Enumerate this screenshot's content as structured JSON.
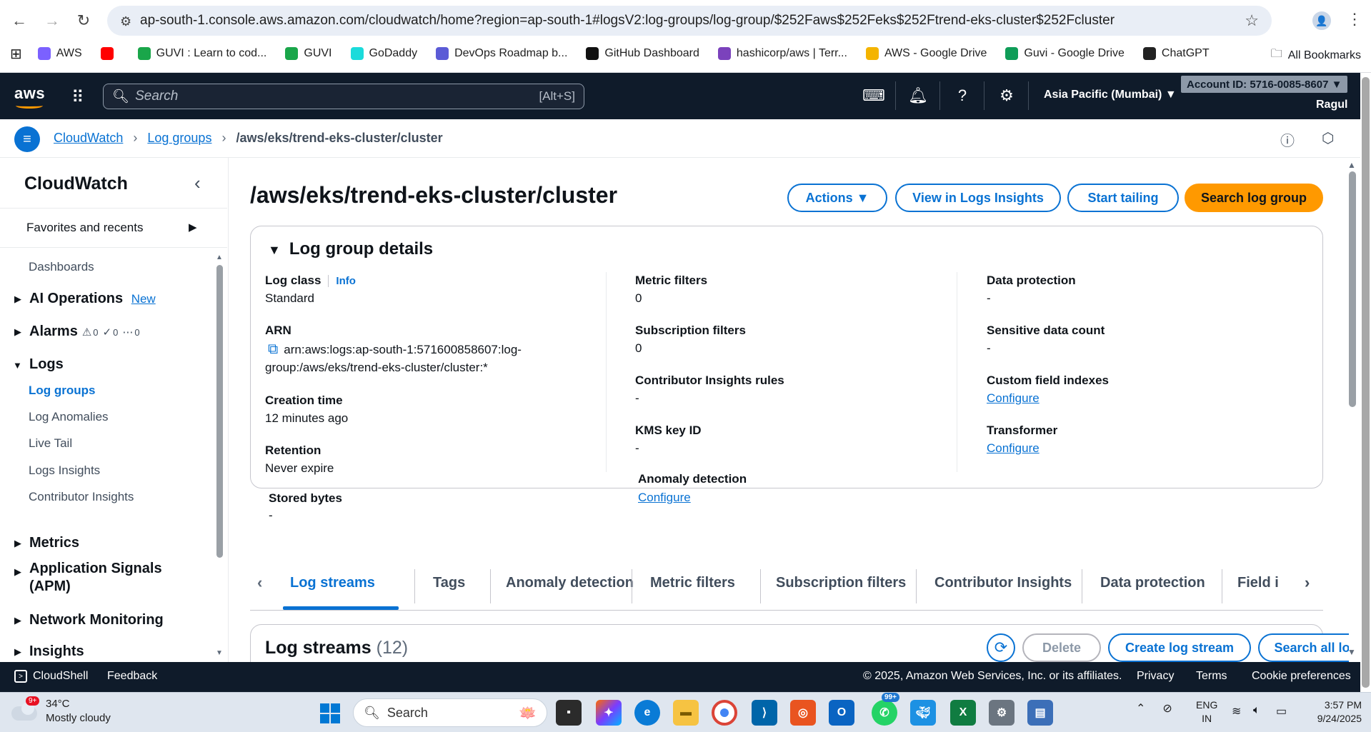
{
  "browser": {
    "url": "ap-south-1.console.aws.amazon.com/cloudwatch/home?region=ap-south-1#logsV2:log-groups/log-group/$252Faws$252Feks$252Ftrend-eks-cluster$252Fcluster",
    "bookmarks": [
      {
        "label": "AWS",
        "icon": "aws-cube-icon",
        "color": "#7b61ff"
      },
      {
        "label": "",
        "icon": "youtube-icon",
        "color": "#ff0000"
      },
      {
        "label": "GUVI : Learn to cod...",
        "icon": "guvi-icon",
        "color": "#1aa64a"
      },
      {
        "label": "GUVI",
        "icon": "guvi-icon",
        "color": "#1aa64a"
      },
      {
        "label": "GoDaddy",
        "icon": "godaddy-icon",
        "color": "#1bdbdb"
      },
      {
        "label": "DevOps Roadmap b...",
        "icon": "roadmap-icon",
        "color": "#5b5bd6"
      },
      {
        "label": "GitHub Dashboard",
        "icon": "github-icon",
        "color": "#111111"
      },
      {
        "label": "hashicorp/aws | Terr...",
        "icon": "terraform-icon",
        "color": "#7b42bc"
      },
      {
        "label": "AWS - Google Drive",
        "icon": "folder-icon",
        "color": "#f4b400"
      },
      {
        "label": "Guvi - Google Drive",
        "icon": "google-drive-icon",
        "color": "#0f9d58"
      },
      {
        "label": "ChatGPT",
        "icon": "chatgpt-icon",
        "color": "#222222"
      }
    ],
    "all_bookmarks": "All Bookmarks"
  },
  "aws_header": {
    "logo": "aws",
    "search_placeholder": "Search",
    "search_shortcut": "[Alt+S]",
    "region": "Asia Pacific (Mumbai) ▼",
    "account": "Account ID: 5716-0085-8607 ▼",
    "user": "Ragul"
  },
  "breadcrumb": {
    "items": [
      "CloudWatch",
      "Log groups"
    ],
    "current": "/aws/eks/trend-eks-cluster/cluster"
  },
  "sidebar": {
    "title": "CloudWatch",
    "favorites": "Favorites and recents",
    "dashboards": "Dashboards",
    "ai_operations": "AI Operations",
    "ai_new": "New",
    "alarms": "Alarms",
    "alarm_counts": [
      "0",
      "0",
      "0"
    ],
    "logs": "Logs",
    "log_items": [
      "Log groups",
      "Log Anomalies",
      "Live Tail",
      "Logs Insights",
      "Contributor Insights"
    ],
    "metrics": "Metrics",
    "app_signals": "Application Signals",
    "app_signals_2": "(APM)",
    "network": "Network Monitoring",
    "insights": "Insights"
  },
  "main": {
    "title": "/aws/eks/trend-eks-cluster/cluster",
    "buttons": {
      "actions": "Actions ▼",
      "view_insights": "View in Logs Insights",
      "start_tailing": "Start tailing",
      "search": "Search log group"
    },
    "details_title": "Log group details",
    "col1": {
      "log_class_label": "Log class",
      "info": "Info",
      "log_class": "Standard",
      "arn_label": "ARN",
      "arn": "arn:aws:logs:ap-south-1:571600858607:log-group:/aws/eks/trend-eks-cluster/cluster:*",
      "creation_label": "Creation time",
      "creation": "12 minutes ago",
      "retention_label": "Retention",
      "retention": "Never expire",
      "stored_label": "Stored bytes",
      "stored": "-"
    },
    "col2": {
      "metric_filters_label": "Metric filters",
      "metric_filters": "0",
      "subscription_label": "Subscription filters",
      "subscription": "0",
      "contributor_label": "Contributor Insights rules",
      "contributor": "-",
      "kms_label": "KMS key ID",
      "kms": "-",
      "anomaly_label": "Anomaly detection",
      "anomaly": "Configure"
    },
    "col3": {
      "data_protection_label": "Data protection",
      "data_protection": "-",
      "sensitive_label": "Sensitive data count",
      "sensitive": "-",
      "custom_label": "Custom field indexes",
      "custom": "Configure",
      "transformer_label": "Transformer",
      "transformer": "Configure"
    },
    "tabs": [
      "Log streams",
      "Tags",
      "Anomaly detection",
      "Metric filters",
      "Subscription filters",
      "Contributor Insights",
      "Data protection",
      "Field i"
    ],
    "streams_title": "Log streams",
    "streams_count": "(12)",
    "stream_buttons": {
      "delete": "Delete",
      "create": "Create log stream",
      "search_all": "Search all log streams"
    }
  },
  "footer": {
    "cloudshell": "CloudShell",
    "feedback": "Feedback",
    "copyright": "© 2025, Amazon Web Services, Inc. or its affiliates.",
    "privacy": "Privacy",
    "terms": "Terms",
    "cookies": "Cookie preferences"
  },
  "taskbar": {
    "weather_badge": "9+",
    "temp": "34°C",
    "condition": "Mostly cloudy",
    "search": "Search",
    "whatsapp_badge": "99+",
    "lang1": "ENG",
    "lang2": "IN",
    "time": "3:57 PM",
    "date": "9/24/2025"
  }
}
